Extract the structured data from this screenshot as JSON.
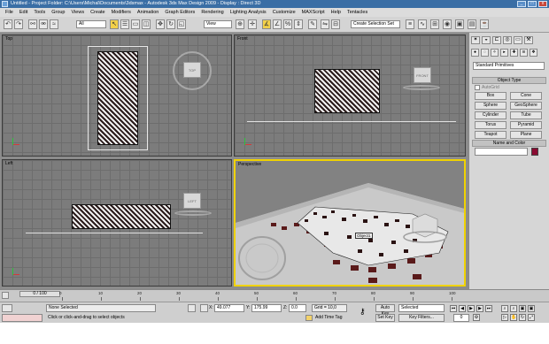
{
  "window": {
    "title": "Untitled    - Project Folder: C:\\Users\\Michal\\Documents\\3dsmax    - Autodesk 3ds Max Design 2009          - Display : Direct 3D",
    "min": "_",
    "max": "□",
    "close": "x"
  },
  "menu": [
    "File",
    "Edit",
    "Tools",
    "Group",
    "Views",
    "Create",
    "Modifiers",
    "Animation",
    "Graph Editors",
    "Rendering",
    "Lighting Analysis",
    "Customize",
    "MAXScript",
    "Help",
    "Tentacles"
  ],
  "toolbar": {
    "selection_filter": "All",
    "ref_coord": "View",
    "named_selection": "Create Selection Set"
  },
  "viewports": {
    "top": {
      "label": "Top",
      "cube": "TOP"
    },
    "front": {
      "label": "Front",
      "cube": "FRONT"
    },
    "left": {
      "label": "Left",
      "cube": "LEFT"
    },
    "perspective": {
      "label": "Perspective",
      "object_label": "Object1"
    }
  },
  "command_panel": {
    "dropdown": "Standard Primitives",
    "object_type": "Object Type",
    "autogrid": "AutoGrid",
    "buttons": [
      "Box",
      "Cone",
      "Sphere",
      "GeoSphere",
      "Cylinder",
      "Tube",
      "Torus",
      "Pyramid",
      "Teapot",
      "Plane"
    ],
    "name_and_color": "Name and Color",
    "swatch_color": "#8a0b32"
  },
  "timeline": {
    "slider": "0 / 100",
    "ticks": [
      "0",
      "10",
      "20",
      "30",
      "40",
      "50",
      "60",
      "70",
      "80",
      "90",
      "100"
    ]
  },
  "status": {
    "selection": "None Selected",
    "prompt": "Click or click-and-drag to select objects",
    "x_label": "X:",
    "x_value": "49.077",
    "y_label": "Y:",
    "y_value": "175.99",
    "z_label": "Z:",
    "z_value": "0.0",
    "grid": "Grid = 10,0",
    "auto_key": "Auto Key",
    "auto_key_mode": "Selected",
    "set_key": "Set Key",
    "key_filters": "Key Filters...",
    "add_time_tag": "Add Time Tag",
    "frame": "0"
  }
}
